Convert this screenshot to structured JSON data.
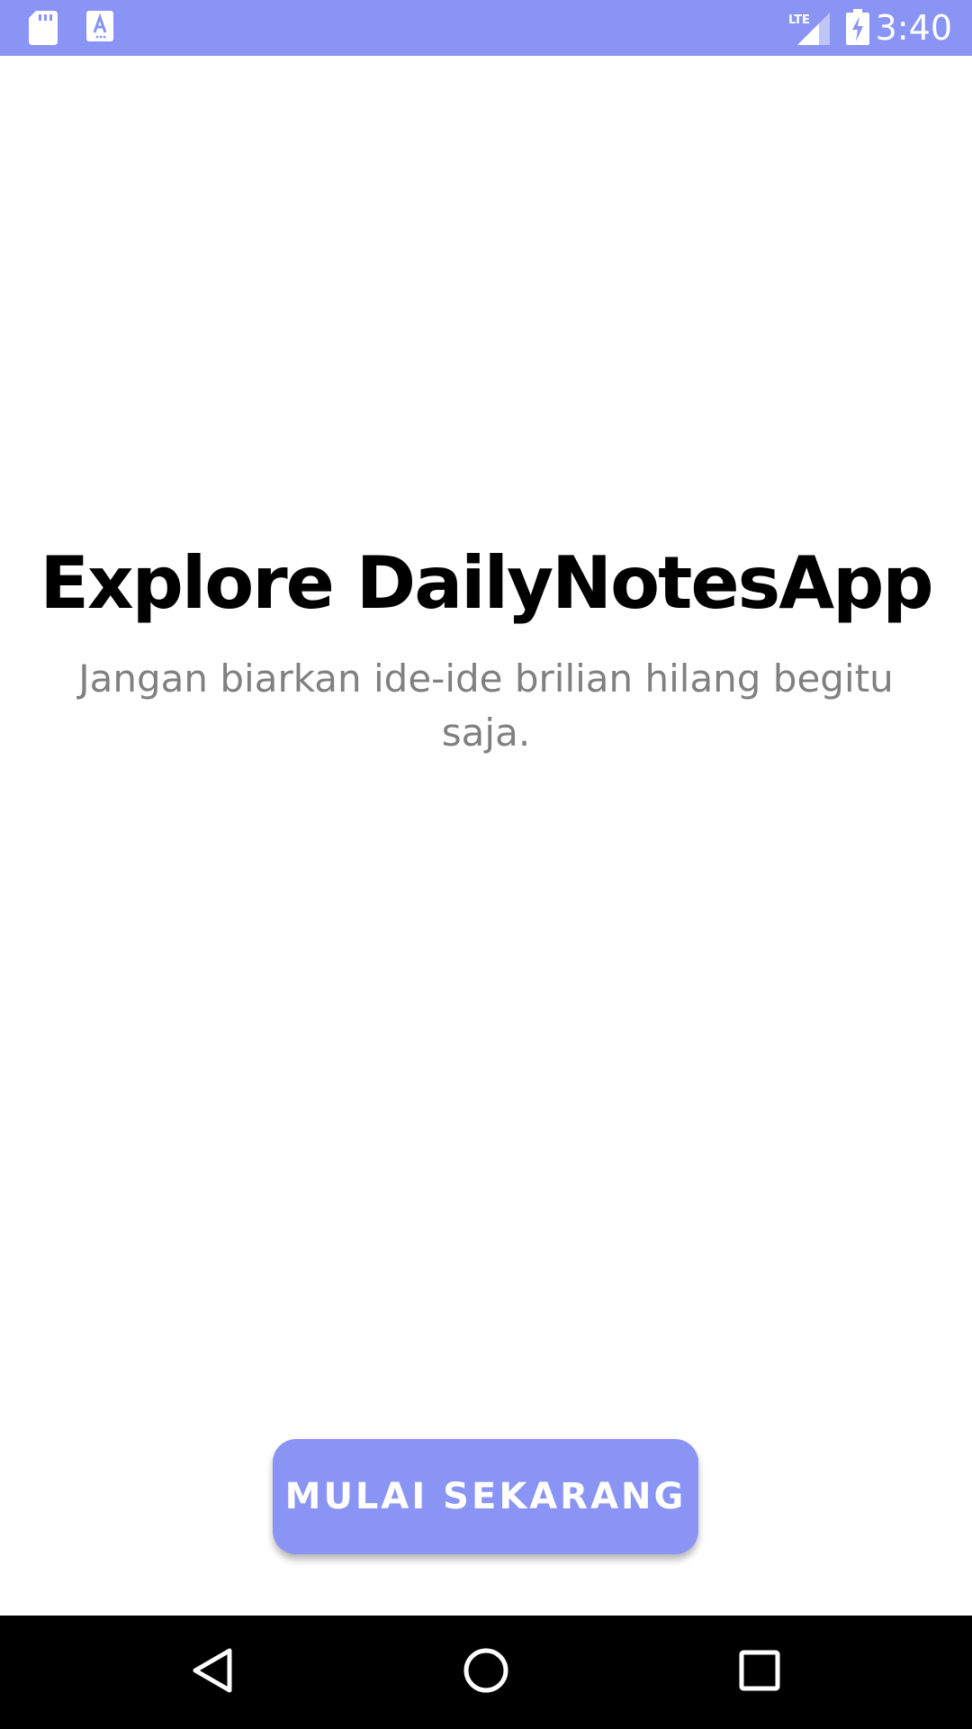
{
  "status_bar": {
    "time": "3:40",
    "network_label": "LTE",
    "background": "#8A94F5",
    "icons": [
      "sd-card-icon",
      "font-a-icon",
      "lte-signal-icon",
      "battery-charging-icon"
    ]
  },
  "onboarding": {
    "title": "Explore DailyNotesApp",
    "subtitle": "Jangan biarkan ide-ide brilian hilang begitu saja.",
    "cta_label": "MULAI SEKARANG",
    "accent_color": "#8A94F5",
    "subtitle_color": "#808080"
  },
  "nav_bar": {
    "buttons": [
      "back-icon",
      "home-icon",
      "recents-icon"
    ]
  }
}
